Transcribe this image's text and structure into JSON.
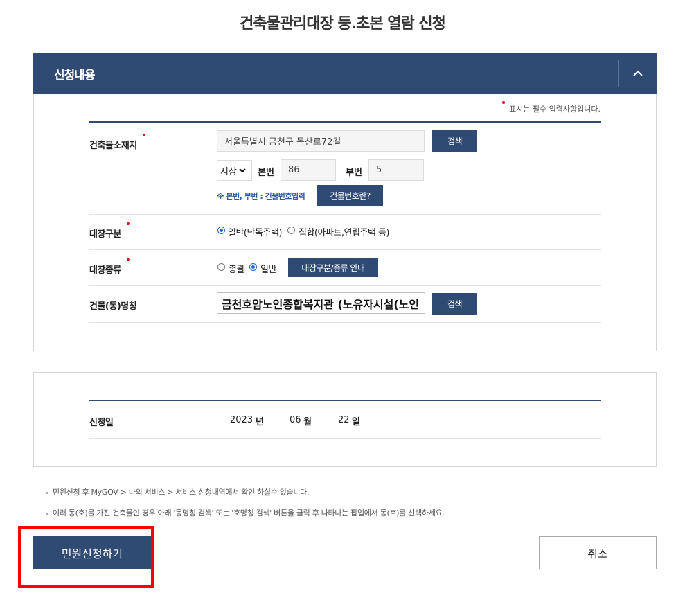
{
  "page": {
    "title": "건축물관리대장 등.초본 열람 신청"
  },
  "section": {
    "header_label": "신청내용",
    "required_note": "표시는 필수 입력사항입니다."
  },
  "form": {
    "location": {
      "label": "건축물소재지",
      "address_value": "서울특별시 금천구 독산로72길",
      "search_label": "검색",
      "ground_select": "지상",
      "main_no_label": "본번",
      "main_no_value": "86",
      "sub_no_label": "부번",
      "sub_no_value": "5",
      "hint": "※ 본번, 부번 : 건물번호입력",
      "building_no_button": "건물번호란?"
    },
    "register_type": {
      "label": "대장구분",
      "option_general": "일반(단독주택)",
      "option_collective": "집합(아파트,연립주택 등)",
      "selected": "general"
    },
    "register_kind": {
      "label": "대장종류",
      "option_total": "총괄",
      "option_general": "일반",
      "selected": "general",
      "guide_button": "대장구분/종류 안내"
    },
    "building_name": {
      "label": "건물(동)명칭",
      "value": "금천호암노인종합복지관 (노유자시설(노인",
      "search_label": "검색"
    }
  },
  "application": {
    "date_label": "신청일",
    "year": "2023",
    "year_unit": "년",
    "month": "06",
    "month_unit": "월",
    "day": "22",
    "day_unit": "일"
  },
  "notes": [
    "민원신청 후 MyGOV > 나의 서비스 > 서비스 신청내역에서 확인 하실수 있습니다.",
    "여러 동(호)를 가진 건축물인 경우 아래 '동명칭 검색' 또는 '호명칭 검색' 버튼을 클릭 후 나타나는 팝업에서 동(호)를 선택하세요."
  ],
  "actions": {
    "submit_label": "민원신청하기",
    "cancel_label": "취소"
  },
  "colors": {
    "navy": "#2f4a73",
    "required_dot": "#e60012",
    "highlight": "#ff0000"
  }
}
